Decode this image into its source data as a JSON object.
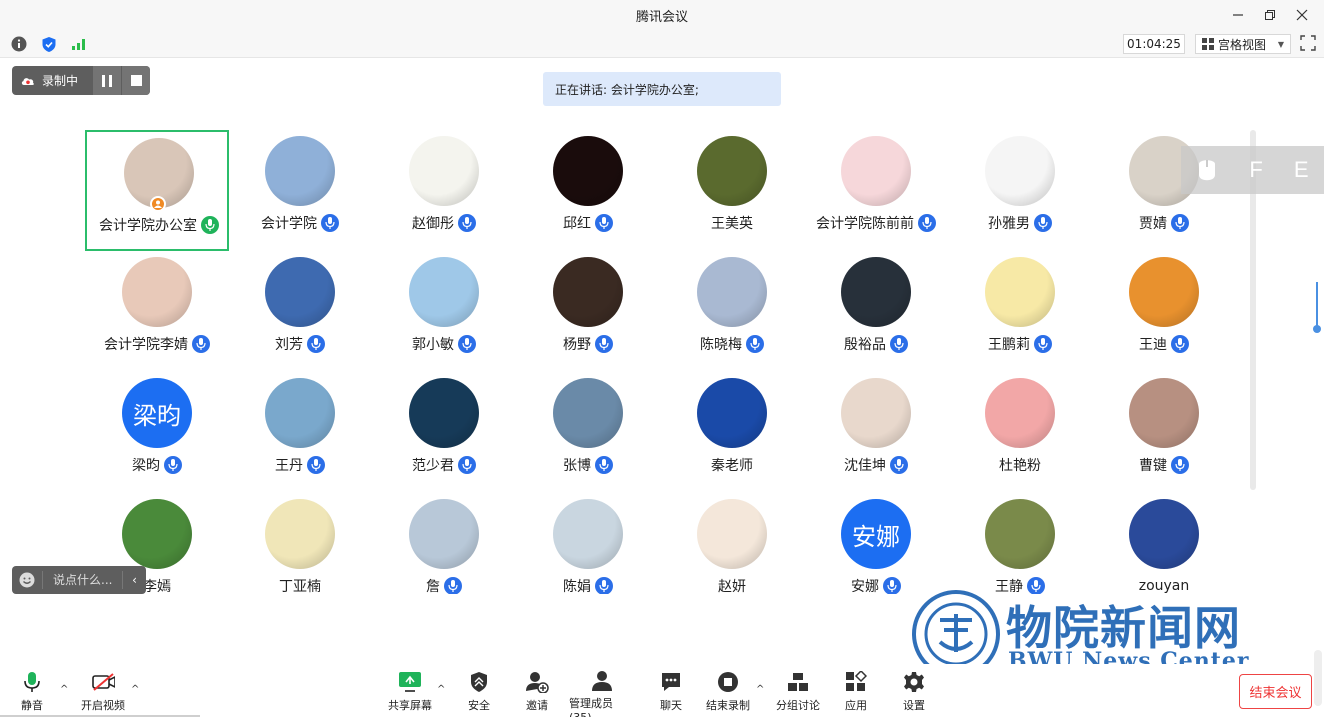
{
  "window": {
    "title": "腾讯会议"
  },
  "toolbar": {
    "timer": "01:04:25",
    "view_mode": "宫格视图"
  },
  "recording": {
    "label": "录制中"
  },
  "speaking": {
    "text": "正在讲话: 会计学院办公室;"
  },
  "overlay": {
    "letters": [
      "F",
      "E"
    ]
  },
  "participants": [
    {
      "name": "会计学院办公室",
      "avatar_color": "#d9c6b8",
      "mic": "green",
      "active": true,
      "host": true
    },
    {
      "name": "会计学院",
      "avatar_color": "#8fb0d8",
      "mic": "blue"
    },
    {
      "name": "赵御彤",
      "avatar_color": "#f4f4ee",
      "mic": "blue"
    },
    {
      "name": "邱红",
      "avatar_color": "#1a0c0c",
      "mic": "blue"
    },
    {
      "name": "王美英",
      "avatar_color": "#5a6a2e",
      "mic": "none"
    },
    {
      "name": "会计学院陈前前",
      "avatar_color": "#f6d7da",
      "mic": "blue"
    },
    {
      "name": "孙雅男",
      "avatar_color": "#f5f5f5",
      "mic": "blue"
    },
    {
      "name": "贾婧",
      "avatar_color": "#d9d2c8",
      "mic": "blue"
    },
    {
      "name": "会计学院李婧",
      "avatar_color": "#e8c9b9",
      "mic": "blue"
    },
    {
      "name": "刘芳",
      "avatar_color": "#3e6ab0",
      "mic": "blue"
    },
    {
      "name": "郭小敏",
      "avatar_color": "#9fc8e8",
      "mic": "blue"
    },
    {
      "name": "杨野",
      "avatar_color": "#3a2a22",
      "mic": "blue"
    },
    {
      "name": "陈晓梅",
      "avatar_color": "#a9b9d2",
      "mic": "blue"
    },
    {
      "name": "殷裕品",
      "avatar_color": "#27303a",
      "mic": "blue"
    },
    {
      "name": "王鹏莉",
      "avatar_color": "#f7e9a6",
      "mic": "blue"
    },
    {
      "name": "王迪",
      "avatar_color": "#e8912e",
      "mic": "blue"
    },
    {
      "name": "梁昀",
      "avatar_text": "梁昀",
      "mic": "blue"
    },
    {
      "name": "王丹",
      "avatar_color": "#7aa8cc",
      "mic": "blue"
    },
    {
      "name": "范少君",
      "avatar_color": "#163a58",
      "mic": "blue"
    },
    {
      "name": "张博",
      "avatar_color": "#6a8aa8",
      "mic": "blue"
    },
    {
      "name": "秦老师",
      "avatar_color": "#1a4aa8",
      "mic": "none"
    },
    {
      "name": "沈佳坤",
      "avatar_color": "#e8d8cc",
      "mic": "blue"
    },
    {
      "name": "杜艳粉",
      "avatar_color": "#f2a7a7",
      "mic": "none"
    },
    {
      "name": "曹键",
      "avatar_color": "#b79081",
      "mic": "blue"
    },
    {
      "name": "李嫣",
      "avatar_color": "#4a8a3a",
      "mic": "none"
    },
    {
      "name": "丁亚楠",
      "avatar_color": "#f0e6b8",
      "mic": "none"
    },
    {
      "name": "詹",
      "avatar_color": "#b8c8d8",
      "mic": "blue"
    },
    {
      "name": "陈娟",
      "avatar_color": "#c9d6e0",
      "mic": "blue"
    },
    {
      "name": "赵妍",
      "avatar_color": "#f4e7da",
      "mic": "none"
    },
    {
      "name": "安娜",
      "avatar_text": "安娜",
      "mic": "blue"
    },
    {
      "name": "王静",
      "avatar_color": "#7a8a4a",
      "mic": "blue"
    },
    {
      "name": "zouyan",
      "avatar_color": "#2a4a9a",
      "mic": "none"
    }
  ],
  "chat": {
    "placeholder": "说点什么..."
  },
  "watermark": {
    "cn": "物院新闻网",
    "en": "BWU News Center"
  },
  "bottom": {
    "mute": "静音",
    "video": "开启视频",
    "share": "共享屏幕",
    "security": "安全",
    "invite": "邀请",
    "members": "管理成员(35)",
    "chat": "聊天",
    "end_record": "结束录制",
    "breakout": "分组讨论",
    "apps": "应用",
    "settings": "设置",
    "end_meeting": "结束会议"
  },
  "colors": {
    "accent": "#1c6ef2",
    "speaking_bg": "#dde9fb",
    "active_border": "#2bbd6b",
    "danger": "#e33333"
  }
}
